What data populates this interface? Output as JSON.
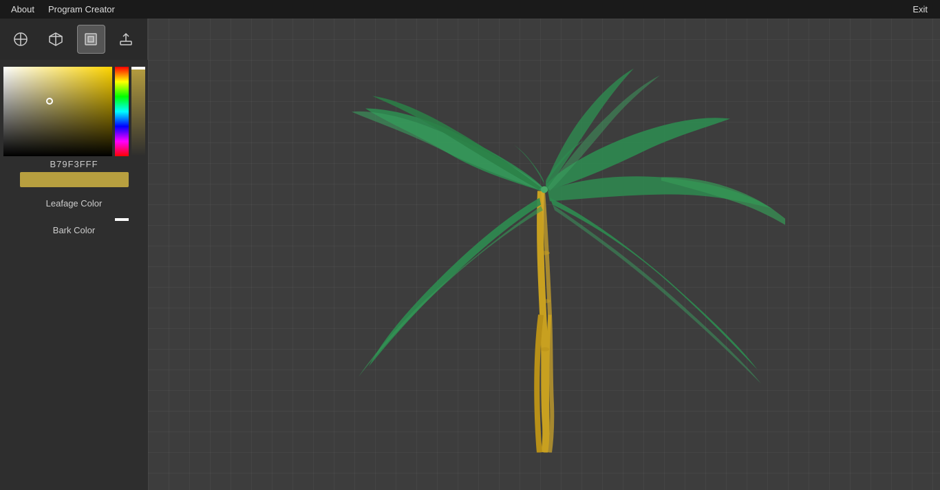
{
  "menubar": {
    "about_label": "About",
    "program_creator_label": "Program Creator",
    "exit_label": "Exit"
  },
  "toolbar": {
    "tool_pin_title": "Pin Tool",
    "tool_3d_title": "3D Object Tool",
    "tool_material_title": "Material Tool",
    "tool_export_title": "Export Tool"
  },
  "color_picker": {
    "hex_value": "B79F3FFF",
    "swatch_color": "#b79f3f",
    "leafage_label": "Leafage Color",
    "bark_label": "Bark Color"
  },
  "viewport": {
    "background_color": "#3d3d3d"
  }
}
